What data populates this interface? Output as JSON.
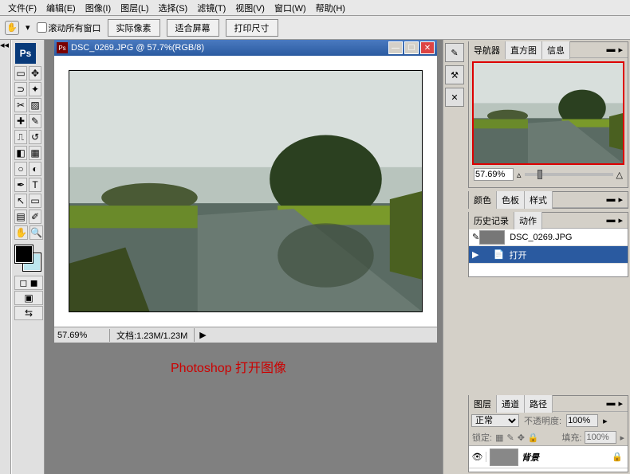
{
  "menu": {
    "file": "文件(F)",
    "edit": "编辑(E)",
    "image": "图像(I)",
    "layer": "图层(L)",
    "select": "选择(S)",
    "filter": "滤镜(T)",
    "view": "视图(V)",
    "window": "窗口(W)",
    "help": "帮助(H)"
  },
  "opt": {
    "scroll_all": "滚动所有窗口",
    "actual": "实际像素",
    "fit": "适合屏幕",
    "print": "打印尺寸"
  },
  "doc": {
    "title": "DSC_0269.JPG @ 57.7%(RGB/8)",
    "zoom": "57.69%",
    "info": "文档:1.23M/1.23M"
  },
  "caption": "Photoshop 打开图像",
  "nav": {
    "t1": "导航器",
    "t2": "直方图",
    "t3": "信息",
    "zoom": "57.69%"
  },
  "color": {
    "t1": "颜色",
    "t2": "色板",
    "t3": "样式"
  },
  "history": {
    "t1": "历史记录",
    "t2": "动作",
    "file": "DSC_0269.JPG",
    "open": "打开"
  },
  "layer": {
    "t1": "图层",
    "t2": "通道",
    "t3": "路径",
    "mode": "正常",
    "opacity_lbl": "不透明度:",
    "opacity": "100%",
    "lock_lbl": "锁定:",
    "fill_lbl": "填充:",
    "fill": "100%",
    "bg": "背景"
  }
}
